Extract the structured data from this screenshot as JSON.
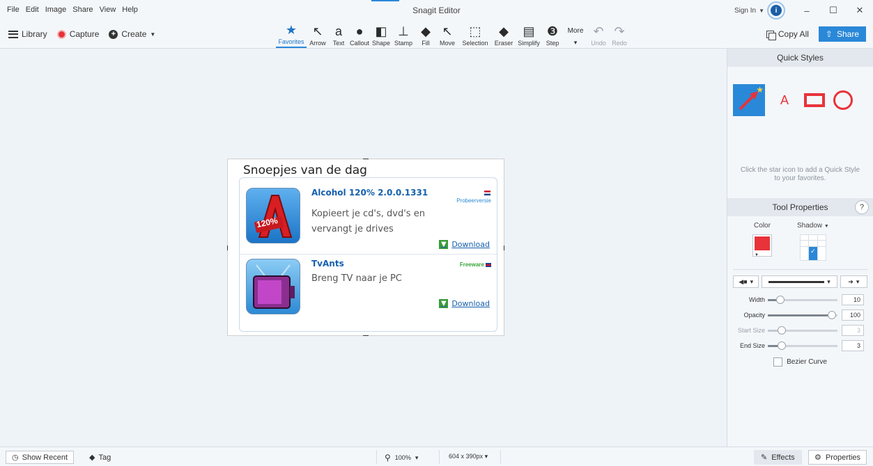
{
  "app": {
    "title": "Snagit Editor",
    "menu": [
      "File",
      "Edit",
      "Image",
      "Share",
      "View",
      "Help"
    ],
    "sign_in": "Sign In"
  },
  "toolbar": {
    "library": "Library",
    "capture": "Capture",
    "create": "Create",
    "tools": [
      {
        "label": "Favorites",
        "icon": "star-icon"
      },
      {
        "label": "Arrow",
        "icon": "arrow-icon"
      },
      {
        "label": "Text",
        "icon": "text-icon"
      },
      {
        "label": "Callout",
        "icon": "callout-icon"
      },
      {
        "label": "Shape",
        "icon": "shape-icon"
      },
      {
        "label": "Stamp",
        "icon": "stamp-icon"
      },
      {
        "label": "Fill",
        "icon": "fill-icon"
      },
      {
        "label": "Move",
        "icon": "move-icon"
      },
      {
        "label": "Selection",
        "icon": "selection-icon"
      },
      {
        "label": "Eraser",
        "icon": "eraser-icon"
      },
      {
        "label": "Simplify",
        "icon": "simplify-icon"
      },
      {
        "label": "Step",
        "icon": "step-icon"
      }
    ],
    "more": "More",
    "undo": "Undo",
    "redo": "Redo",
    "copy_all": "Copy All",
    "share": "Share"
  },
  "capture": {
    "heading": "Snoepjes van de dag",
    "items": [
      {
        "name": "Alcohol 120% 2.0.0.1331",
        "description": "Kopieert je cd's, dvd's en vervangt je drives",
        "badge": "Probeerversie",
        "download": "Download",
        "icon_text": "120%"
      },
      {
        "name": "TvAnts",
        "description": "Breng TV naar je PC",
        "badge": "Freeware",
        "download": "Download"
      }
    ]
  },
  "panel": {
    "quick_styles": "Quick Styles",
    "qs_text_sample": "A",
    "qs_hint": "Click the star icon to add a Quick Style to your favorites.",
    "tool_properties": "Tool Properties",
    "help": "?",
    "color_label": "Color",
    "shadow_label": "Shadow",
    "sliders": [
      {
        "label": "Width",
        "value": "10",
        "percent": 18,
        "disabled": false
      },
      {
        "label": "Opacity",
        "value": "100",
        "percent": 92,
        "disabled": false
      },
      {
        "label": "Start Size",
        "value": "3",
        "percent": 20,
        "disabled": true
      },
      {
        "label": "End Size",
        "value": "3",
        "percent": 20,
        "disabled": false
      }
    ],
    "bezier": "Bezier Curve"
  },
  "status": {
    "show_recent": "Show Recent",
    "tag": "Tag",
    "zoom": "100%",
    "dimensions": "604 x 390px",
    "effects": "Effects",
    "properties": "Properties"
  },
  "colors": {
    "accent": "#2a88d8",
    "tool_color": "#e8333a"
  }
}
